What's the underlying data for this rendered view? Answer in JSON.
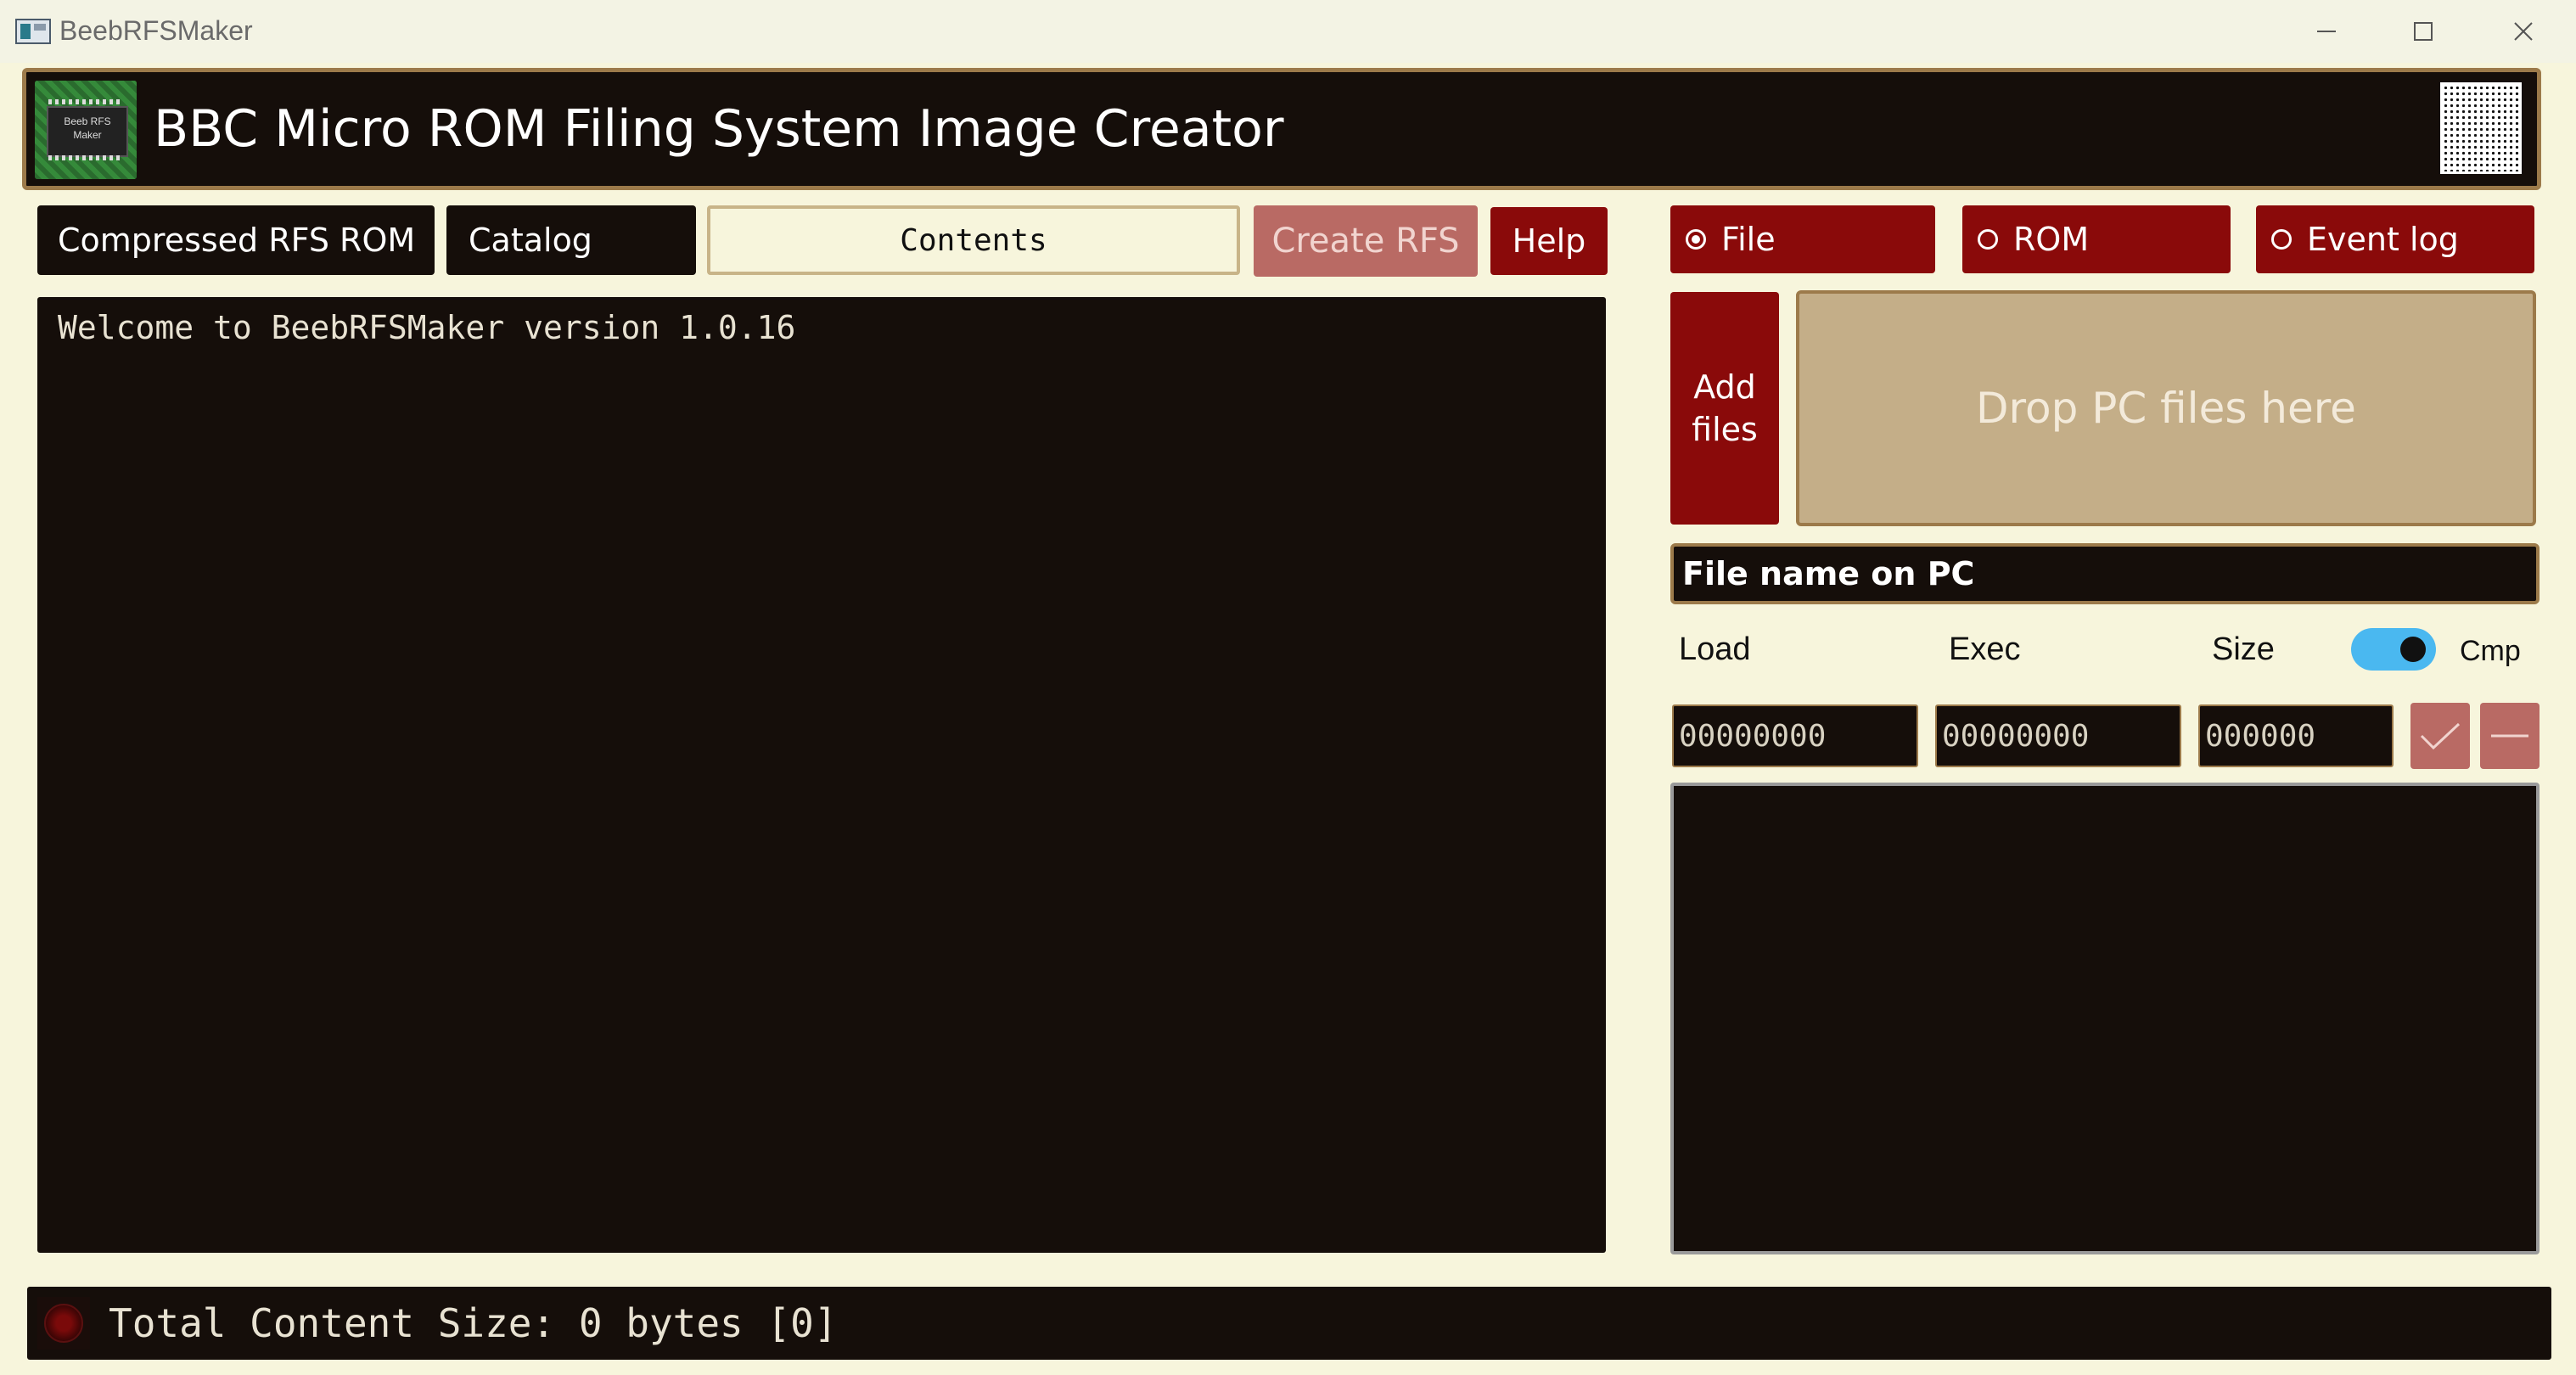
{
  "window": {
    "title": "BeebRFSMaker",
    "minimize_icon": "minimize-icon",
    "maximize_icon": "maximize-icon",
    "close_icon": "close-icon"
  },
  "header": {
    "title": "BBC Micro ROM Filing System Image Creator",
    "logo_icon": "rom-chip-icon",
    "logo_text": "Beeb RFS Maker",
    "owl_icon": "acorn-owl-icon"
  },
  "tabs": {
    "compressed": "Compressed RFS ROM",
    "catalog": "Catalog",
    "contents": "Contents"
  },
  "actions": {
    "create": "Create RFS",
    "help": "Help"
  },
  "terminal": {
    "welcome": "Welcome to BeebRFSMaker version 1.0.16"
  },
  "view_mode": {
    "options": [
      "File",
      "ROM",
      "Event log"
    ],
    "selected": "File"
  },
  "files": {
    "add_label_1": "Add",
    "add_label_2": "files",
    "drop_label": "Drop PC files here",
    "filename_label": "File name on PC"
  },
  "attributes": {
    "load_label": "Load",
    "exec_label": "Exec",
    "size_label": "Size",
    "cmp_label": "Cmp",
    "cmp_enabled": true,
    "load_value": "00000000",
    "exec_value": "00000000",
    "size_value": "000000",
    "ok_icon": "checkmark-icon",
    "remove_icon": "minus-icon"
  },
  "status": {
    "text": "Total Content Size: 0 bytes [0]",
    "indicator_icon": "status-led-icon"
  },
  "colors": {
    "background": "#f7f5dc",
    "panel": "#150e0a",
    "accent": "#8a0a0a",
    "disabled_accent": "#b96a64",
    "border": "#9c7a4a",
    "drop": "#c4ae88",
    "toggle": "#4ab8f0"
  }
}
